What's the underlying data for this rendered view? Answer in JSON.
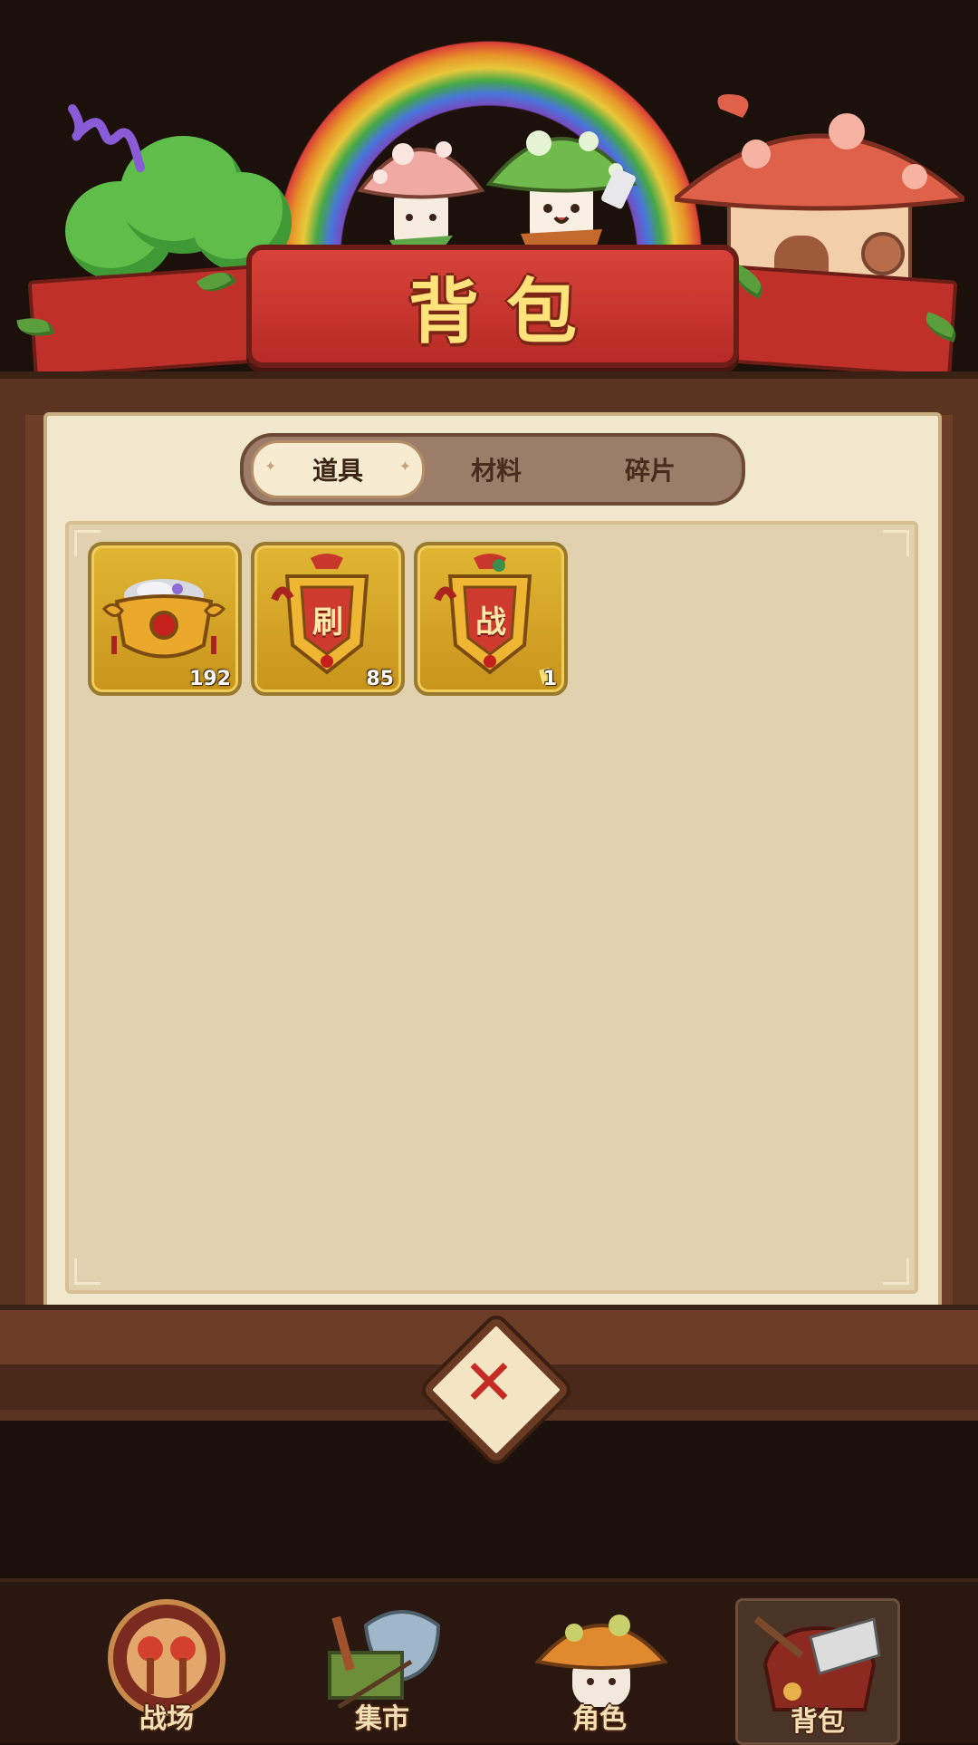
{
  "title": "背包",
  "tabs": [
    {
      "label": "道具",
      "active": true
    },
    {
      "label": "材料",
      "active": false
    },
    {
      "label": "碎片",
      "active": false
    }
  ],
  "items": [
    {
      "name": "treasure-pot",
      "count": "192",
      "glyph": ""
    },
    {
      "name": "token-shua",
      "count": "85",
      "glyph": "刷"
    },
    {
      "name": "token-zhan",
      "count": "1",
      "glyph": "战"
    }
  ],
  "nav": [
    {
      "label": "战场",
      "icon": "drum-icon",
      "active": false
    },
    {
      "label": "集市",
      "icon": "market-umbrella-icon",
      "active": false
    },
    {
      "label": "角色",
      "icon": "mushroom-character-icon",
      "active": false
    },
    {
      "label": "背包",
      "icon": "backpack-icon",
      "active": true
    }
  ],
  "colors": {
    "banner": "#c0302b",
    "panel": "#f1e7cd",
    "slot": "#d9a82a"
  }
}
